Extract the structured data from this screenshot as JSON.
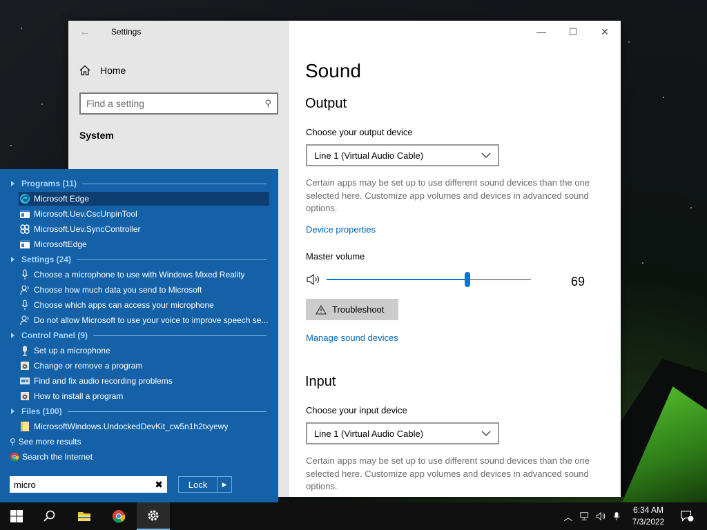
{
  "settings": {
    "window_title": "Settings",
    "home_label": "Home",
    "search_placeholder": "Find a setting",
    "category": "System",
    "page_title": "Sound",
    "output_heading": "Output",
    "output_label": "Choose your output device",
    "output_device": "Line 1 (Virtual Audio Cable)",
    "output_desc": "Certain apps may be set up to use different sound devices than the one selected here. Customize app volumes and devices in advanced sound options.",
    "device_properties": "Device properties",
    "master_volume_label": "Master volume",
    "volume_value": "69",
    "volume_fraction": 0.69,
    "troubleshoot": "Troubleshoot",
    "manage_devices": "Manage sound devices",
    "input_heading": "Input",
    "input_label": "Choose your input device",
    "input_device": "Line 1 (Virtual Audio Cable)",
    "input_desc": "Certain apps may be set up to use different sound devices than the one selected here. Customize app volumes and devices in advanced sound options.",
    "caption": {
      "minimize": "—",
      "maximize": "☐",
      "close": "✕"
    }
  },
  "start_search": {
    "groups": [
      {
        "title": "Programs (11)"
      },
      {
        "title": "Settings (24)"
      },
      {
        "title": "Control Panel (9)"
      },
      {
        "title": "Files (100)"
      }
    ],
    "programs": [
      {
        "label": "Microsoft Edge",
        "icon": "edge-icon"
      },
      {
        "label": "Microsoft.Uev.CscUnpinTool",
        "icon": "app-window-icon"
      },
      {
        "label": "Microsoft.Uev.SyncController",
        "icon": "sync-controller-icon"
      },
      {
        "label": "MicrosoftEdge",
        "icon": "app-window-icon"
      }
    ],
    "settings_items": [
      {
        "label": "Choose a microphone to use with Windows Mixed Reality",
        "icon": "microphone-icon"
      },
      {
        "label": "Choose how much data you send to Microsoft",
        "icon": "person-voice-icon"
      },
      {
        "label": "Choose which apps can access your microphone",
        "icon": "microphone-icon"
      },
      {
        "label": "Do not allow Microsoft to use your voice to improve speech se...",
        "icon": "person-voice-icon"
      }
    ],
    "control_panel": [
      {
        "label": "Set up a microphone",
        "icon": "microphone-icon"
      },
      {
        "label": "Change or remove a program",
        "icon": "program-icon"
      },
      {
        "label": "Find and fix audio recording problems",
        "icon": "troubleshoot-icon"
      },
      {
        "label": "How to install a program",
        "icon": "program-icon"
      }
    ],
    "files": [
      {
        "label": "MicrosoftWindows.UndockedDevKit_cw5n1h2txyewy",
        "icon": "folder-icon"
      }
    ],
    "see_more": "See more results",
    "search_internet": "Search the Internet",
    "query": "micro",
    "clear": "✖",
    "lock_label": "Lock",
    "lock_arrow": "▶"
  },
  "taskbar": {
    "time": "6:34 AM",
    "date": "7/3/2022",
    "notification_count": "1",
    "tray_chevron": "︿"
  },
  "colors": {
    "accent": "#0078d7",
    "link": "#0063b1",
    "start_bg": "#1461a8",
    "selected_item": "#0d3e6f"
  }
}
